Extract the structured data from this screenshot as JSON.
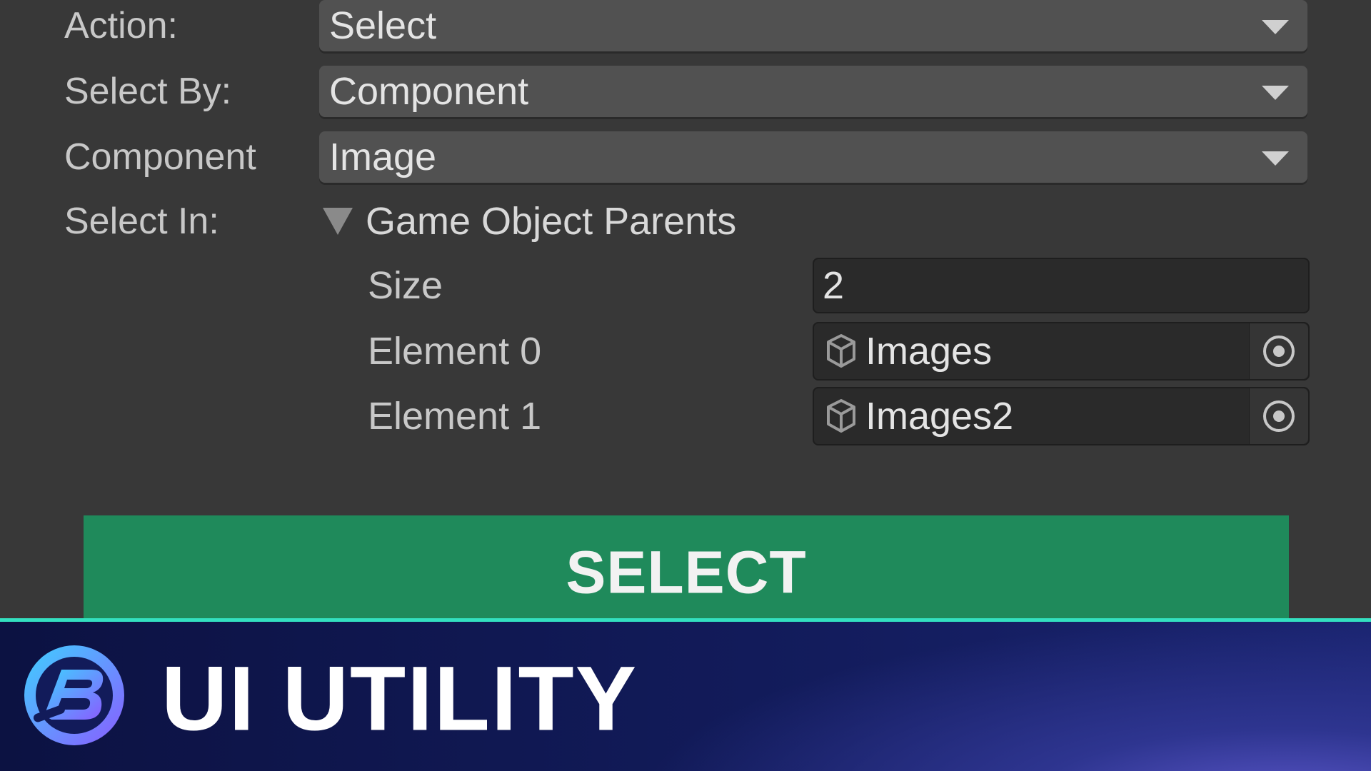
{
  "inspector": {
    "action": {
      "label": "Action:",
      "value": "Select"
    },
    "select_by": {
      "label": "Select By:",
      "value": "Component"
    },
    "component": {
      "label": "Component",
      "value": "Image"
    },
    "select_in": {
      "label": "Select In:",
      "foldout_label": "Game Object Parents",
      "size_label": "Size",
      "size_value": "2",
      "elements": [
        {
          "label": "Element 0",
          "value": "Images"
        },
        {
          "label": "Element 1",
          "value": "Images2"
        }
      ]
    },
    "select_button_label": "SELECT"
  },
  "banner": {
    "title": "UI UTILITY",
    "accent_line_color": "#33e0c0"
  },
  "colors": {
    "panel_bg": "#383838",
    "dropdown_bg": "#515151",
    "field_bg": "#2a2a2a",
    "button_green": "#1f8a5b",
    "banner_navy": "#121b5a"
  },
  "icons": {
    "dropdown": "triangle-down-icon",
    "foldout": "foldout-expanded-icon",
    "object": "gameobject-cube-icon",
    "picker": "object-picker-icon",
    "logo": "brand-logo-icon"
  }
}
